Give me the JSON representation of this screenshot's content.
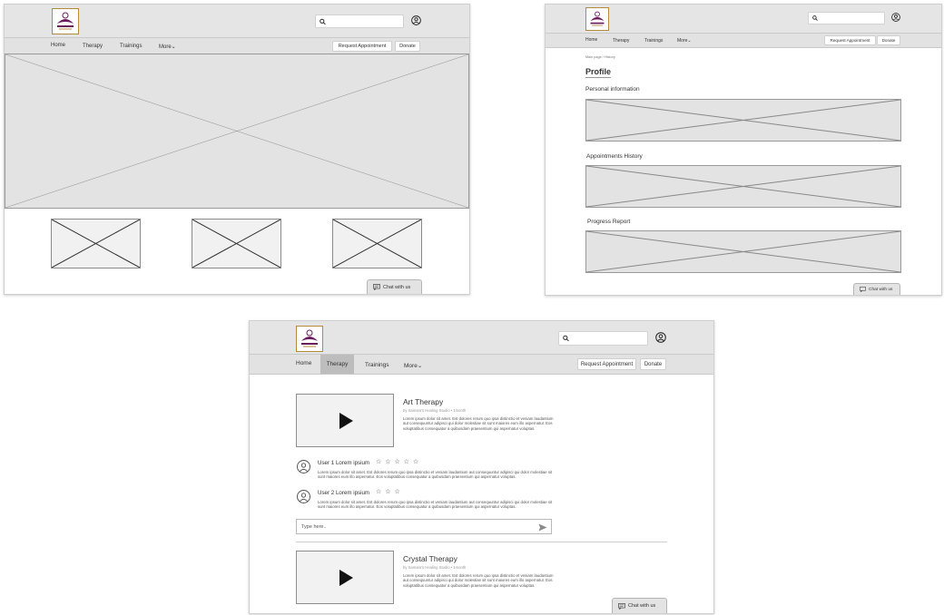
{
  "nav": {
    "home": "Home",
    "therapy": "Therapy",
    "trainings": "Trainings",
    "more": "More",
    "request_appointment": "Request Appointment",
    "donate": "Donate"
  },
  "search": {
    "placeholder": ""
  },
  "chat": {
    "label": "Chat with us"
  },
  "profile": {
    "breadcrumb_home": "Main page",
    "breadcrumb_current": "History",
    "title": "Profile",
    "sections": [
      "Personal information",
      "Appointments History",
      "Progress Report"
    ]
  },
  "therapy_page": {
    "selected_tab": "Therapy",
    "videos": [
      {
        "title": "Art Therapy",
        "meta": "by Samara's Healing Studio • 1month",
        "description": "Lorem ipsum dolor sit amet. Est dolores rerum quo ipsa distinctio et veniam laudantium aut consequuntur adipisci qui dolor molestiae sit sunt maiores eum illo aspernatur. Eos voluptatibus consequatur a quibusdam praesentium qui aspernatur voluptas."
      },
      {
        "title": "Crystal Therapy",
        "meta": "by Samara's Healing Studio • 1month",
        "description": "Lorem ipsum dolor sit amet. Est dolores rerum quo ipsa distinctio et veniam laudantium aut consequuntur adipisci qui dolor molestiae sit sunt maiores eum illo aspernatur. Eos voluptatibus consequatur a quibusdam praesentium qui aspernatur voluptas."
      }
    ],
    "comments": [
      {
        "user": "User 1 Lorem ipsium",
        "stars": "☆ ☆ ☆ ☆ ☆",
        "text": "Lorem ipsum dolor sit amet. Est dolores rerum quo ipsa distinctio et veniam laudantium aut consequuntur adipisci qui dolor molestiae sit sunt maiores eum illo aspernatur. Eos voluptatibus consequatur a quibusdam praesentium qui aspernatur voluptas."
      },
      {
        "user": "User 2 Lorem ipsium",
        "stars": "☆ ☆ ☆",
        "text": "Lorem ipsum dolor sit amet. Est dolores rerum quo ipsa distinctio et veniam laudantium aut consequuntur adipisci qui dolor molestiae sit sunt maiores eum illo aspernatur. Eos voluptatibus consequatur a quibusdam praesentium qui aspernatur voluptas."
      }
    ],
    "message_placeholder": "Type here.."
  },
  "icons": {
    "search": "search-icon",
    "user": "user-circle-icon",
    "chat": "chat-bubble-icon",
    "send": "send-icon",
    "play": "play-icon",
    "more": "chevron-down-icon"
  },
  "colors": {
    "header_bg": "#e5e5e5",
    "placeholder_bg": "#e3e3e3",
    "selected_tab": "#bdbdbd",
    "logo_purple": "#6a1b5b",
    "logo_gold": "#b48a3b"
  }
}
